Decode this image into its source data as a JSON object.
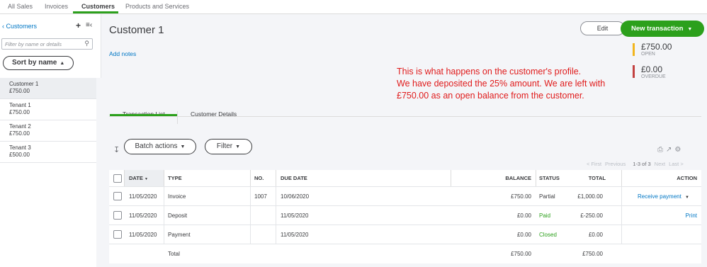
{
  "topnav": {
    "tabs": [
      "All Sales",
      "Invoices",
      "Customers",
      "Products and Services"
    ],
    "active": "Customers"
  },
  "sidebar": {
    "header": "Customers",
    "search_placeholder": "Filter by name or details",
    "sort_label": "Sort by name",
    "items": [
      {
        "name": "Customer 1",
        "amount": "£750.00"
      },
      {
        "name": "Tenant 1",
        "amount": "£750.00"
      },
      {
        "name": "Tenant 2",
        "amount": "£750.00"
      },
      {
        "name": "Tenant 3",
        "amount": "£500.00"
      }
    ]
  },
  "customer": {
    "title": "Customer 1",
    "add_notes": "Add notes",
    "edit_label": "Edit",
    "new_transaction_label": "New transaction",
    "open_amount": "£750.00",
    "open_label": "OPEN",
    "overdue_amount": "£0.00",
    "overdue_label": "OVERDUE"
  },
  "annotation": {
    "line1": "This is what happens on the customer's profile.",
    "line2": "We have deposited the 25% amount. We are left with",
    "line3": "£750.00 as an open balance from the customer."
  },
  "tabs": {
    "transaction_list": "Transaction List",
    "customer_details": "Customer Details"
  },
  "toolbar": {
    "batch_actions": "Batch actions",
    "filter": "Filter"
  },
  "pager": {
    "first": "< First",
    "previous": "Previous",
    "range": "1-3 of 3",
    "next": "Next",
    "last": "Last >"
  },
  "table": {
    "headers": {
      "date": "DATE",
      "type": "TYPE",
      "no": "NO.",
      "due_date": "DUE DATE",
      "balance": "BALANCE",
      "total": "TOTAL",
      "status": "STATUS",
      "action": "ACTION"
    },
    "rows": [
      {
        "date": "11/05/2020",
        "type": "Invoice",
        "no": "1007",
        "due_date": "10/06/2020",
        "balance": "£750.00",
        "total": "£1,000.00",
        "status": "Partial",
        "action": "Receive payment"
      },
      {
        "date": "11/05/2020",
        "type": "Deposit",
        "no": "",
        "due_date": "11/05/2020",
        "balance": "£0.00",
        "total": "£-250.00",
        "status": "Paid",
        "action": "Print"
      },
      {
        "date": "11/05/2020",
        "type": "Payment",
        "no": "",
        "due_date": "11/05/2020",
        "balance": "£0.00",
        "total": "£0.00",
        "status": "Closed",
        "action": ""
      }
    ],
    "total_row": {
      "label": "Total",
      "balance": "£750.00",
      "total": "£750.00"
    }
  },
  "colors": {
    "brand_green": "#2ca01c",
    "link_blue": "#0077c5",
    "open_yellow": "#f2b51e",
    "overdue_red": "#c24141",
    "annotation_red": "#e01b1b"
  }
}
